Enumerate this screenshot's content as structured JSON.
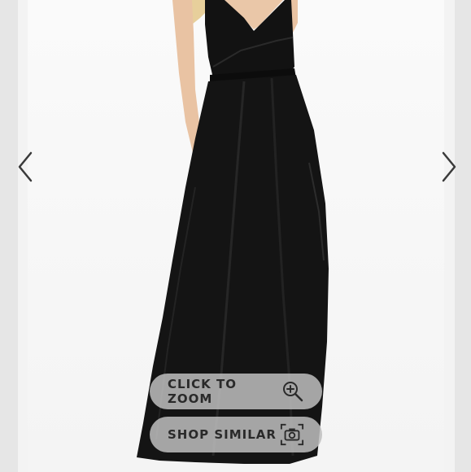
{
  "gallery": {
    "prev_icon": "chevron-left-icon",
    "next_icon": "chevron-right-icon",
    "colors": {
      "background": "#f4f4f4",
      "dress": "#111111",
      "skin": "#e9c3a3",
      "hair": "#e7cf9b",
      "pill": "#bebebe",
      "text": "#2a2a2a"
    }
  },
  "actions": {
    "zoom_label": "CLICK TO ZOOM",
    "zoom_icon": "zoom-in-icon",
    "similar_label": "SHOP SIMILAR",
    "similar_icon": "camera-icon"
  }
}
